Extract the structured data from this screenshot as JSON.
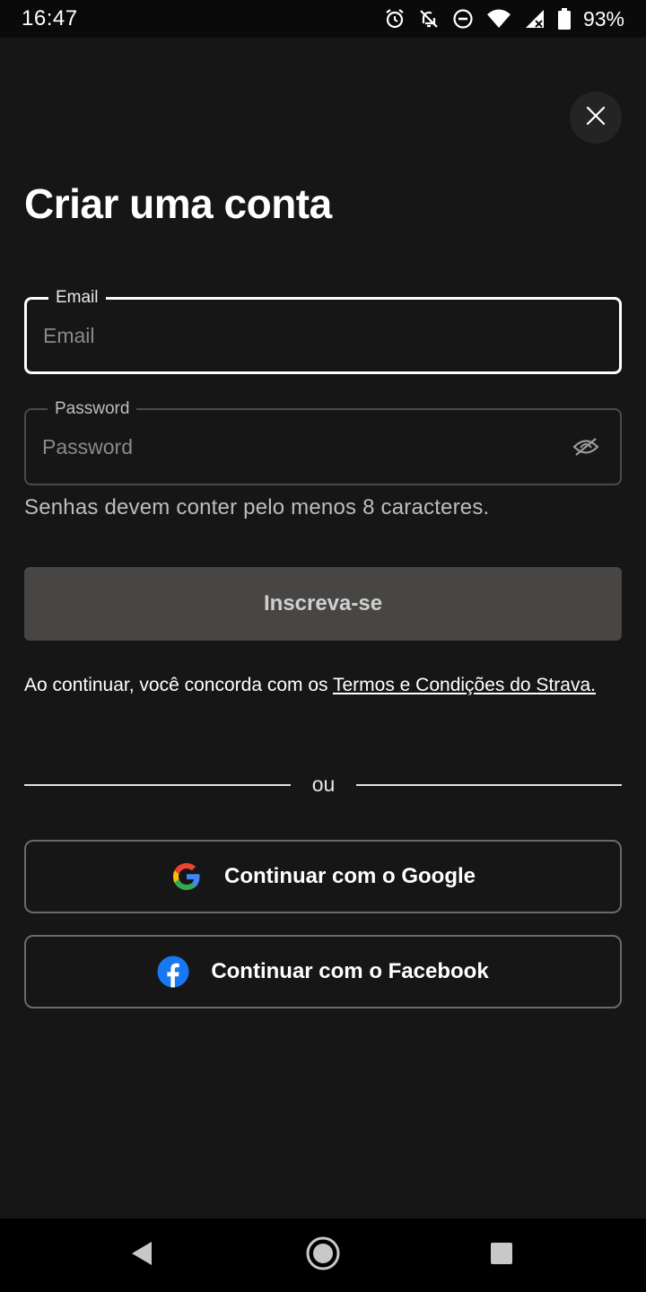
{
  "status_bar": {
    "time": "16:47",
    "icons": [
      "alarm-icon",
      "notifications-off-icon",
      "do-not-disturb-icon",
      "wifi-icon",
      "signal-icon",
      "battery-icon"
    ],
    "battery": "93%"
  },
  "header": {
    "close_icon": "close-icon",
    "title": "Criar uma conta"
  },
  "form": {
    "email": {
      "label": "Email",
      "placeholder": "Email",
      "value": ""
    },
    "password": {
      "label": "Password",
      "placeholder": "Password",
      "value": "",
      "toggle_icon": "eye-off-icon"
    },
    "helper": "Senhas devem conter pelo menos 8 caracteres.",
    "submit_label": "Inscreva-se"
  },
  "terms": {
    "prefix": "Ao continuar, você concorda com os ",
    "link": "Termos e Condições do Strava."
  },
  "divider": {
    "text": "ou"
  },
  "social": {
    "google": {
      "label": "Continuar com o Google",
      "icon": "google-icon"
    },
    "facebook": {
      "label": "Continuar com o Facebook",
      "icon": "facebook-icon"
    }
  },
  "nav": {
    "back": "back-icon",
    "home": "home-icon",
    "recent": "recents-icon"
  },
  "colors": {
    "background": "#161616",
    "button_disabled": "#484644",
    "facebook_blue": "#1877F2"
  }
}
